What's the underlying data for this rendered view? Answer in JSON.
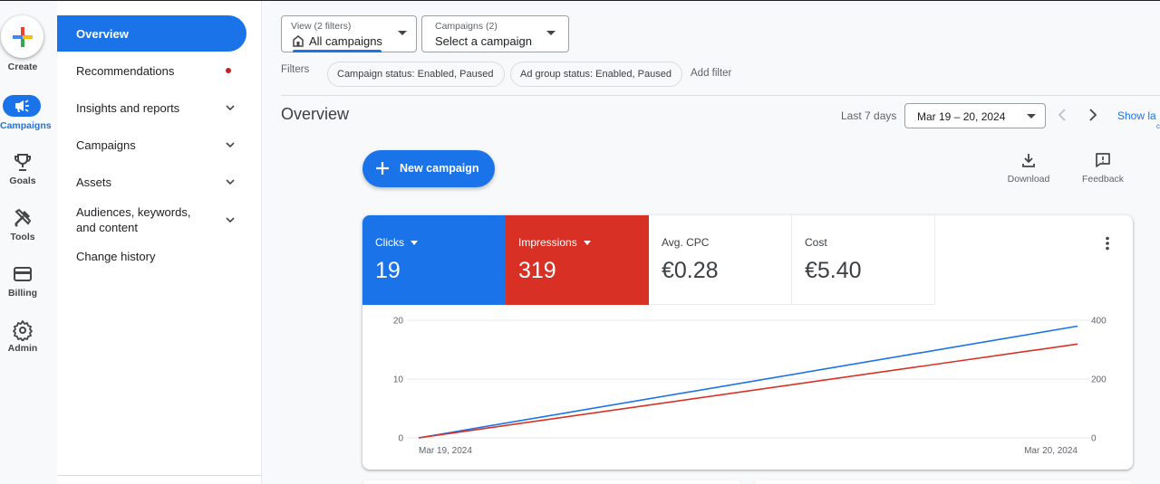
{
  "rail": {
    "create": "Create",
    "campaigns": "Campaigns",
    "goals": "Goals",
    "tools": "Tools",
    "billing": "Billing",
    "admin": "Admin"
  },
  "nav": {
    "overview": "Overview",
    "recommendations": "Recommendations",
    "insights": "Insights and reports",
    "campaigns": "Campaigns",
    "assets": "Assets",
    "audiences": "Audiences, keywords, and content",
    "change_history": "Change history"
  },
  "view_dropdown": {
    "caption": "View (2 filters)",
    "value": "All campaigns"
  },
  "campaign_dropdown": {
    "caption": "Campaigns (2)",
    "value": "Select a campaign"
  },
  "filters": {
    "label": "Filters",
    "chips": [
      "Campaign status: Enabled, Paused",
      "Ad group status: Enabled, Paused"
    ],
    "add": "Add filter"
  },
  "header": {
    "title": "Overview",
    "range_label": "Last 7 days",
    "date": "Mar 19 – 20, 2024",
    "show_link": "Show la",
    "show_link_2": "c"
  },
  "new_campaign": "New campaign",
  "tools": {
    "download": "Download",
    "feedback": "Feedback"
  },
  "metrics": {
    "clicks": {
      "label": "Clicks",
      "value": "19"
    },
    "impressions": {
      "label": "Impressions",
      "value": "319"
    },
    "avg_cpc": {
      "label": "Avg. CPC",
      "value": "€0.28"
    },
    "cost": {
      "label": "Cost",
      "value": "€5.40"
    }
  },
  "colors": {
    "blue": "#1a73e8",
    "red": "#d93025"
  },
  "chart_data": {
    "type": "line",
    "x": [
      "Mar 19, 2024",
      "Mar 20, 2024"
    ],
    "series": [
      {
        "name": "Clicks",
        "axis": "left",
        "values": [
          0,
          19
        ]
      },
      {
        "name": "Impressions",
        "axis": "right",
        "values": [
          0,
          319
        ]
      }
    ],
    "y_left": {
      "ticks": [
        0,
        10,
        20
      ],
      "lim": [
        0,
        20
      ]
    },
    "y_right": {
      "ticks": [
        0,
        200,
        400
      ],
      "lim": [
        0,
        400
      ]
    },
    "grid": true
  }
}
